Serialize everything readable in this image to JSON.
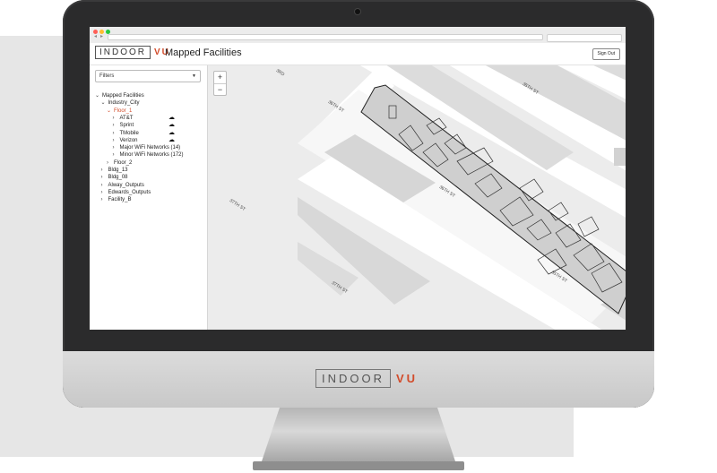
{
  "brand": {
    "logo_word": "INDOOR",
    "logo_accent": "VU",
    "accent_color": "#d24b2a"
  },
  "header": {
    "title": "Mapped Facilities",
    "signout_label": "Sign Out"
  },
  "sidebar": {
    "filters_label": "Filters",
    "tree": [
      {
        "label": "Mapped Facilities",
        "expanded": true,
        "level": 0
      },
      {
        "label": "Industry_City",
        "expanded": true,
        "level": 1
      },
      {
        "label": "Floor_1",
        "expanded": true,
        "level": 2,
        "active": true
      },
      {
        "label": "AT&T",
        "level": 3,
        "cloud": true
      },
      {
        "label": "Sprint",
        "level": 3,
        "cloud": true
      },
      {
        "label": "TMobile",
        "level": 3,
        "cloud": true
      },
      {
        "label": "Verizon",
        "level": 3,
        "cloud": true
      },
      {
        "label": "Major WiFi Networks (14)",
        "level": 3
      },
      {
        "label": "Minor WiFi Networks (172)",
        "level": 3
      },
      {
        "label": "Floor_2",
        "level": 2
      },
      {
        "label": "Bldg_13",
        "level": 1
      },
      {
        "label": "Bldg_08",
        "level": 1
      },
      {
        "label": "Alway_Outputs",
        "level": 1
      },
      {
        "label": "Edwards_Outputs",
        "level": 1
      },
      {
        "label": "Facility_B",
        "level": 1
      }
    ]
  },
  "map": {
    "zoom_in_label": "+",
    "zoom_out_label": "−",
    "street_labels": [
      "36TH ST",
      "36TH ST",
      "37TH ST",
      "37TH ST",
      "35TH ST",
      "35TH ST",
      "3RD"
    ]
  },
  "icons": {
    "cloud": "cloud-icon",
    "tree_expand": "chevron-down-icon",
    "tree_collapse": "chevron-right-icon"
  }
}
